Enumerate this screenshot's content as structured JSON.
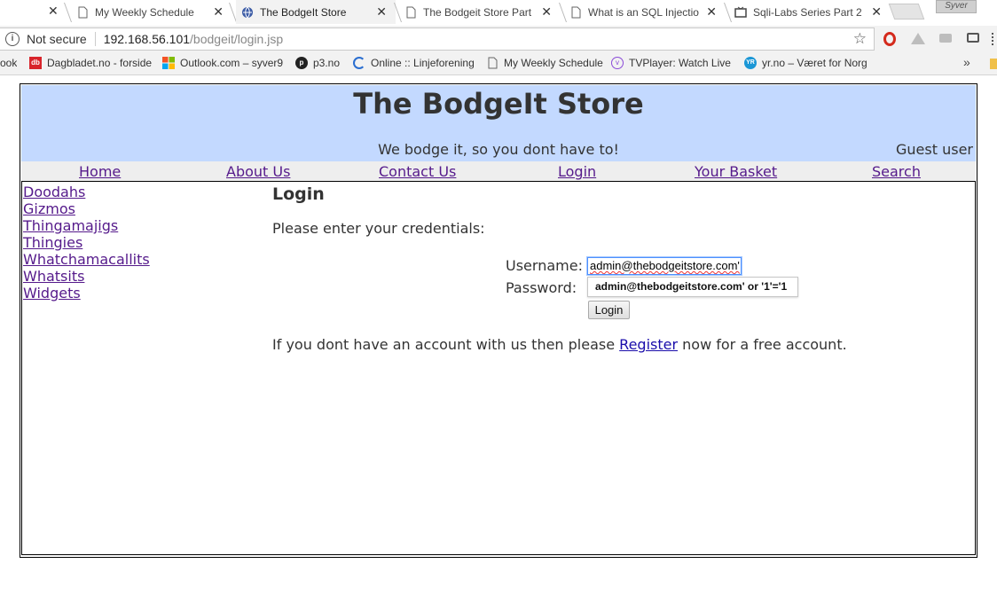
{
  "browser": {
    "tabs": [
      {
        "title": "My Weekly Schedule"
      },
      {
        "title": "The BodgeIt Store"
      },
      {
        "title": "The Bodgeit Store Part"
      },
      {
        "title": "What is an SQL Injectio"
      },
      {
        "title": "Sqli-Labs Series Part 2"
      }
    ],
    "profile_name": "Syver",
    "security_label": "Not secure",
    "url_host": "192.168.56.101",
    "url_path": "/bodgeit/login.jsp",
    "bookmarks": [
      {
        "label": "ook"
      },
      {
        "label": "Dagbladet.no - forside"
      },
      {
        "label": "Outlook.com – syver9"
      },
      {
        "label": "p3.no"
      },
      {
        "label": "Online :: Linjeforening"
      },
      {
        "label": "My Weekly Schedule"
      },
      {
        "label": "TVPlayer: Watch Live T"
      },
      {
        "label": "yr.no – Været for Norg"
      }
    ],
    "more_bookmarks": "»"
  },
  "site": {
    "title": "The BodgeIt Store",
    "tagline": "We bodge it, so you dont have to!",
    "user_status": "Guest user",
    "nav": {
      "home": "Home",
      "about": "About Us",
      "contact": "Contact Us",
      "login": "Login",
      "basket": "Your Basket",
      "search": "Search"
    },
    "categories": [
      "Doodahs",
      "Gizmos",
      "Thingamajigs",
      "Thingies",
      "Whatchamacallits",
      "Whatsits",
      "Widgets"
    ]
  },
  "login": {
    "heading": "Login",
    "prompt": "Please enter your credentials:",
    "username_label": "Username:",
    "username_value": "admin@thebodgeitstore.com'",
    "password_label": "Password:",
    "autocomplete_suggestion": "admin@thebodgeitstore.com' or '1'='1",
    "submit_label": "Login",
    "register_prefix": "If you dont have an account with us then please",
    "register_link": "Register",
    "register_suffix": "now for a free account."
  }
}
